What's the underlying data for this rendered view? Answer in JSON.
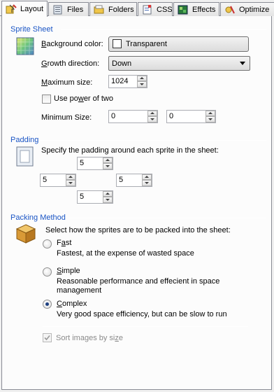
{
  "tabs": [
    {
      "label": "Layout",
      "icon": "layout-icon",
      "active": true
    },
    {
      "label": "Files",
      "icon": "files-icon"
    },
    {
      "label": "Folders",
      "icon": "folder-icon"
    },
    {
      "label": "CSS",
      "icon": "css-icon"
    },
    {
      "label": "Effects",
      "icon": "effects-icon"
    },
    {
      "label": "Optimize",
      "icon": "optimize-icon"
    }
  ],
  "sprite_sheet": {
    "title": "Sprite Sheet",
    "background_color_label": "Background color:",
    "background_color_value": "Transparent",
    "growth_direction_label": "Growth direction:",
    "growth_direction_value": "Down",
    "maximum_size_label": "Maximum size:",
    "maximum_size_value": "1024",
    "power_of_two_label": "Use power of two",
    "power_of_two_checked": false,
    "minimum_size_label": "Minimum Size:",
    "minimum_width": "0",
    "minimum_height": "0"
  },
  "padding": {
    "title": "Padding",
    "description": "Specify the padding around each sprite in the sheet:",
    "top": "5",
    "left": "5",
    "right": "5",
    "bottom": "5"
  },
  "packing": {
    "title": "Packing Method",
    "description": "Select how the sprites are to be packed into the sheet:",
    "options": [
      {
        "label": "Fast",
        "desc": "Fastest, at the expense of wasted space",
        "selected": false
      },
      {
        "label": "Simple",
        "desc": "Reasonable performance and effecient in space management",
        "selected": false
      },
      {
        "label": "Complex",
        "desc": "Very good space efficiency, but can be slow to run",
        "selected": true
      }
    ],
    "sort_label": "Sort images by size",
    "sort_checked": true
  },
  "colors": {
    "section_title": "#1a55c5",
    "radio_dot": "#1d3f80"
  }
}
